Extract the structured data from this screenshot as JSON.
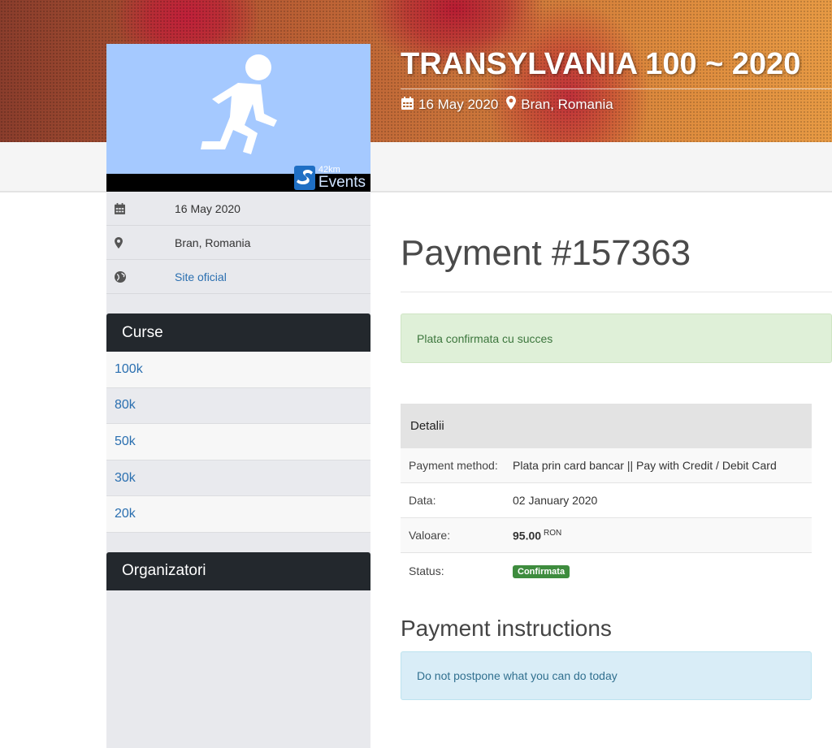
{
  "event": {
    "title": "TRANSYLVANIA 100 ~ 2020",
    "date": "16 May 2020",
    "location": "Bran, Romania"
  },
  "sidebar": {
    "brand_small": "42km",
    "brand_large": "Events",
    "info": {
      "date": "16 May 2020",
      "location": "Bran, Romania",
      "site_link": "Site oficial"
    },
    "courses_heading": "Curse",
    "courses": [
      "100k",
      "80k",
      "50k",
      "30k",
      "20k"
    ],
    "organizers_heading": "Organizatori"
  },
  "main": {
    "title": "Payment #157363",
    "success_message": "Plata confirmata cu succes",
    "details": {
      "heading": "Detalii",
      "rows": [
        {
          "label": "Payment method:",
          "value": "Plata prin card bancar || Pay with Credit / Debit Card"
        },
        {
          "label": "Data:",
          "value": "02 January 2020"
        },
        {
          "label": "Valoare:",
          "value": "95.00",
          "currency": "RON"
        },
        {
          "label": "Status:",
          "value": "Confirmata"
        }
      ]
    },
    "instructions_heading": "Payment instructions",
    "instructions_text": "Do not postpone what you can do today"
  },
  "colors": {
    "sidebar_heading_bg": "#23282d",
    "link": "#2a6fb0",
    "success_bg": "#dff0d8",
    "info_bg": "#d9edf7",
    "status_badge": "#3e8c3e"
  }
}
